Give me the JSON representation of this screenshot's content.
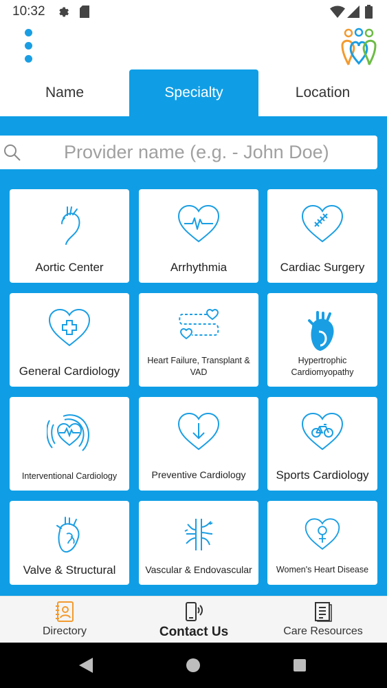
{
  "status_bar": {
    "time": "10:32",
    "icons": [
      "gear-icon",
      "sd-card-icon",
      "wifi-icon",
      "signal-icon",
      "battery-icon"
    ]
  },
  "header": {
    "menu_icon": "more-vertical-icon",
    "logo_icon": "people-hearts-logo",
    "accent_color": "#0f9ee5"
  },
  "tabs": [
    {
      "label": "Name",
      "active": false
    },
    {
      "label": "Specialty",
      "active": true
    },
    {
      "label": "Location",
      "active": false
    }
  ],
  "search": {
    "placeholder": "Provider name (e.g. - John Doe)",
    "value": "",
    "icon": "search-icon"
  },
  "specialties": [
    {
      "label": "Aortic Center",
      "icon": "aorta-icon"
    },
    {
      "label": "Arrhythmia",
      "icon": "heart-pulse-icon"
    },
    {
      "label": "Cardiac Surgery",
      "icon": "heart-stitches-icon"
    },
    {
      "label": "General Cardiology",
      "icon": "heart-plus-icon"
    },
    {
      "label": "Heart Failure, Transplant & VAD",
      "icon": "heart-transfer-icon"
    },
    {
      "label": "Hypertrophic Cardiomyopathy",
      "icon": "anatomical-heart-icon"
    },
    {
      "label": "Interventional Cardiology",
      "icon": "heart-waves-icon"
    },
    {
      "label": "Preventive Cardiology",
      "icon": "heart-down-arrow-icon"
    },
    {
      "label": "Sports Cardiology",
      "icon": "heart-bicycle-icon"
    },
    {
      "label": "Valve & Structural",
      "icon": "heart-valve-icon"
    },
    {
      "label": "Vascular & Endovascular",
      "icon": "blood-vessels-icon"
    },
    {
      "label": "Women's Heart Disease",
      "icon": "heart-female-icon"
    }
  ],
  "bottom_nav": [
    {
      "label": "Directory",
      "icon": "directory-icon",
      "active": false
    },
    {
      "label": "Contact Us",
      "icon": "phone-call-icon",
      "active": true
    },
    {
      "label": "Care Resources",
      "icon": "document-icon",
      "active": false
    }
  ],
  "system_nav": {
    "icons": [
      "back-icon",
      "home-icon",
      "recent-apps-icon"
    ]
  }
}
